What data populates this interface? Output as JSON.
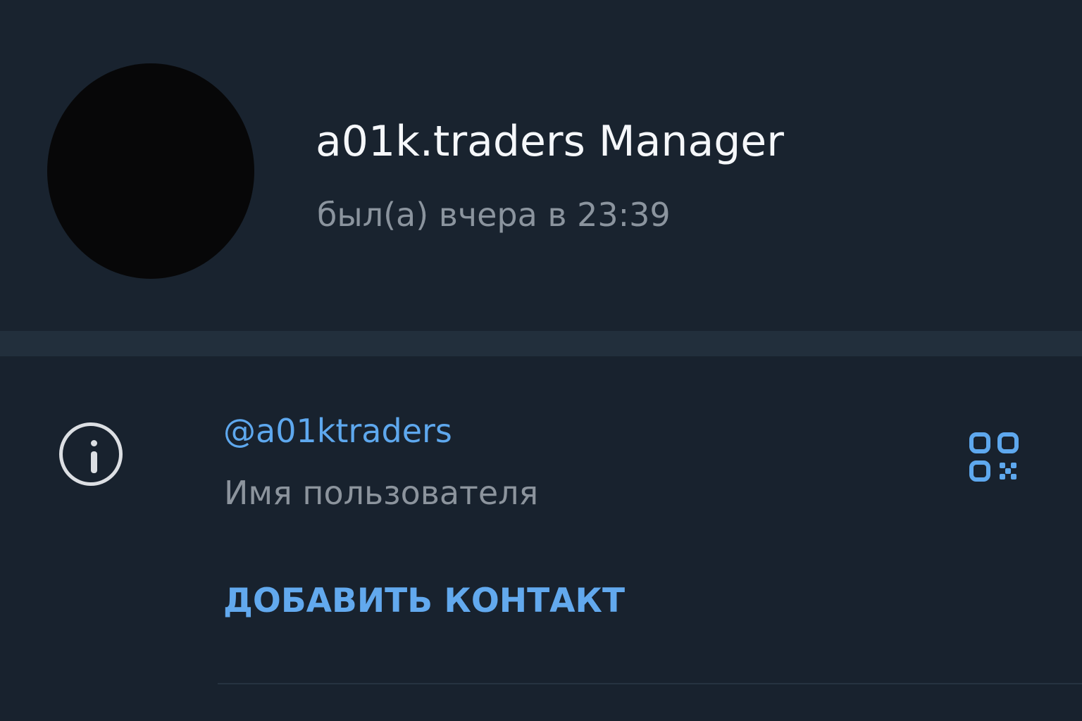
{
  "profile": {
    "name": "a01k.traders Manager",
    "status": "был(а) вчера в 23:39",
    "avatar_color": "#070708"
  },
  "info": {
    "username": "@a01ktraders",
    "username_label": "Имя пользователя",
    "add_contact": "ДОБАВИТЬ КОНТАКТ"
  },
  "icons": {
    "info": "info-circle-icon",
    "qr": "qr-code-icon"
  },
  "colors": {
    "background": "#18222e",
    "accent": "#5ea8ee",
    "secondary_text": "#8c949d",
    "primary_text": "#f5f7fa"
  }
}
